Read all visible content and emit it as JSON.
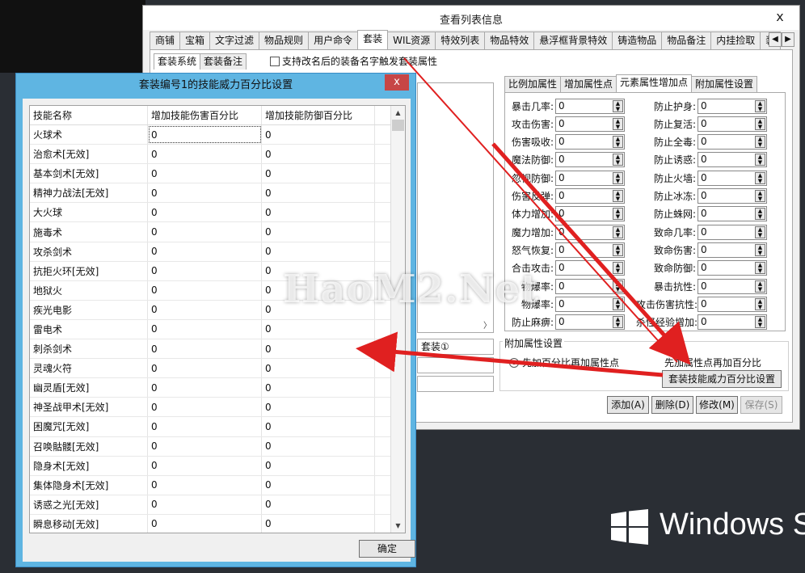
{
  "main_window": {
    "title": "查看列表信息",
    "close_glyph": "x",
    "tabs": [
      "商铺",
      "宝箱",
      "文字过滤",
      "物品规则",
      "用户命令",
      "套装",
      "WIL资源",
      "特效列表",
      "物品特效",
      "悬浮框背景特效",
      "铸造物品",
      "物品备注",
      "内挂捡取",
      "装"
    ],
    "active_tab": "套装",
    "subtabs": [
      "套装系统",
      "套装备注"
    ],
    "support_checkbox_label": "支持改名后的装备名字触发套装属性",
    "left_field_1": "套装①",
    "attr_tabs": [
      "比例加属性",
      "增加属性点",
      "元素属性增加点",
      "附加属性设置"
    ],
    "attr_left": [
      {
        "label": "暴击几率:",
        "value": "0"
      },
      {
        "label": "攻击伤害:",
        "value": "0"
      },
      {
        "label": "伤害吸收:",
        "value": "0"
      },
      {
        "label": "魔法防御:",
        "value": "0"
      },
      {
        "label": "忽视防御:",
        "value": "0"
      },
      {
        "label": "伤害反弹:",
        "value": "0"
      },
      {
        "label": "体力增加:",
        "value": "0"
      },
      {
        "label": "魔力增加:",
        "value": "0"
      },
      {
        "label": "怒气恢复:",
        "value": "0"
      },
      {
        "label": "合击攻击:",
        "value": "0"
      },
      {
        "label": "物爆率:",
        "value": "0"
      },
      {
        "label": "物爆率:",
        "value": "0"
      },
      {
        "label": "防止麻痹:",
        "value": "0"
      }
    ],
    "attr_right": [
      {
        "label": "防止护身:",
        "value": "0"
      },
      {
        "label": "防止复活:",
        "value": "0"
      },
      {
        "label": "防止全毒:",
        "value": "0"
      },
      {
        "label": "防止诱惑:",
        "value": "0"
      },
      {
        "label": "防止火墙:",
        "value": "0"
      },
      {
        "label": "防止冰冻:",
        "value": "0"
      },
      {
        "label": "防止蛛网:",
        "value": "0"
      },
      {
        "label": "致命几率:",
        "value": "0"
      },
      {
        "label": "致命伤害:",
        "value": "0"
      },
      {
        "label": "致命防御:",
        "value": "0"
      },
      {
        "label": "暴击抗性:",
        "value": "0"
      },
      {
        "label": "攻击伤害抗性:",
        "value": "0"
      },
      {
        "label": "杀怪经验增加:",
        "value": "0"
      }
    ],
    "extra_legend": "附加属性设置",
    "radio_1": "先加百分比再加属性点",
    "radio_2": "先加属性点再加百分比",
    "skill_pct_button": "套装技能威力百分比设置",
    "buttons": {
      "add": "添加(A)",
      "delete": "删除(D)",
      "modify": "修改(M)",
      "save": "保存(S)"
    }
  },
  "dialog": {
    "title": "套装编号1的技能威力百分比设置",
    "close_glyph": "x",
    "columns": [
      "技能名称",
      "增加技能伤害百分比",
      "增加技能防御百分比"
    ],
    "rows": [
      [
        "火球术",
        "0",
        "0"
      ],
      [
        "治愈术[无效]",
        "0",
        "0"
      ],
      [
        "基本剑术[无效]",
        "0",
        "0"
      ],
      [
        "精神力战法[无效]",
        "0",
        "0"
      ],
      [
        "大火球",
        "0",
        "0"
      ],
      [
        "施毒术",
        "0",
        "0"
      ],
      [
        "攻杀剑术",
        "0",
        "0"
      ],
      [
        "抗拒火环[无效]",
        "0",
        "0"
      ],
      [
        "地狱火",
        "0",
        "0"
      ],
      [
        "疾光电影",
        "0",
        "0"
      ],
      [
        "雷电术",
        "0",
        "0"
      ],
      [
        "刺杀剑术",
        "0",
        "0"
      ],
      [
        "灵魂火符",
        "0",
        "0"
      ],
      [
        "幽灵盾[无效]",
        "0",
        "0"
      ],
      [
        "神圣战甲术[无效]",
        "0",
        "0"
      ],
      [
        "困魔咒[无效]",
        "0",
        "0"
      ],
      [
        "召唤骷髅[无效]",
        "0",
        "0"
      ],
      [
        "隐身术[无效]",
        "0",
        "0"
      ],
      [
        "集体隐身术[无效]",
        "0",
        "0"
      ],
      [
        "诱惑之光[无效]",
        "0",
        "0"
      ],
      [
        "瞬息移动[无效]",
        "0",
        "0"
      ]
    ],
    "ok_button": "确定"
  },
  "watermark": "HaoM2.Net",
  "os_brand": "Windows Se",
  "colors": {
    "dialog_frame": "#5fb5e2",
    "close_red": "#c74646",
    "arrow_red": "#e02020"
  }
}
